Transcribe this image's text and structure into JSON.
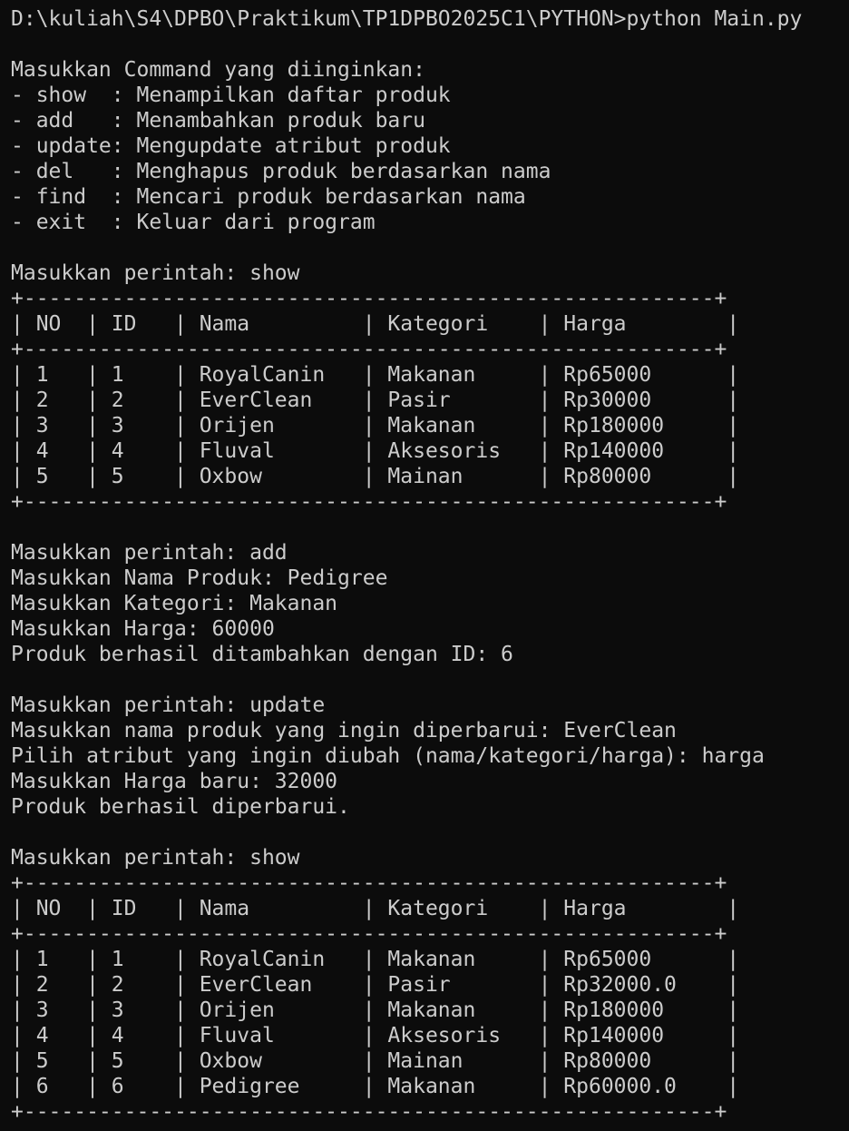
{
  "terminal": {
    "lines": [
      "D:\\kuliah\\S4\\DPBO\\Praktikum\\TP1DPBO2025C1\\PYTHON>python Main.py",
      "",
      "Masukkan Command yang diinginkan:",
      "- show  : Menampilkan daftar produk",
      "- add   : Menambahkan produk baru",
      "- update: Mengupdate atribut produk",
      "- del   : Menghapus produk berdasarkan nama",
      "- find  : Mencari produk berdasarkan nama",
      "- exit  : Keluar dari program",
      "",
      "Masukkan perintah: show",
      "+-------------------------------------------------------+",
      "| NO  | ID   | Nama         | Kategori    | Harga        |",
      "+-------------------------------------------------------+",
      "| 1   | 1    | RoyalCanin   | Makanan     | Rp65000      |",
      "| 2   | 2    | EverClean    | Pasir       | Rp30000      |",
      "| 3   | 3    | Orijen       | Makanan     | Rp180000     |",
      "| 4   | 4    | Fluval       | Aksesoris   | Rp140000     |",
      "| 5   | 5    | Oxbow        | Mainan      | Rp80000      |",
      "+-------------------------------------------------------+",
      "",
      "Masukkan perintah: add",
      "Masukkan Nama Produk: Pedigree",
      "Masukkan Kategori: Makanan",
      "Masukkan Harga: 60000",
      "Produk berhasil ditambahkan dengan ID: 6",
      "",
      "Masukkan perintah: update",
      "Masukkan nama produk yang ingin diperbarui: EverClean",
      "Pilih atribut yang ingin diubah (nama/kategori/harga): harga",
      "Masukkan Harga baru: 32000",
      "Produk berhasil diperbarui.",
      "",
      "Masukkan perintah: show",
      "+-------------------------------------------------------+",
      "| NO  | ID   | Nama         | Kategori    | Harga        |",
      "+-------------------------------------------------------+",
      "| 1   | 1    | RoyalCanin   | Makanan     | Rp65000      |",
      "| 2   | 2    | EverClean    | Pasir       | Rp32000.0    |",
      "| 3   | 3    | Orijen       | Makanan     | Rp180000     |",
      "| 4   | 4    | Fluval       | Aksesoris   | Rp140000     |",
      "| 5   | 5    | Oxbow        | Mainan      | Rp80000      |",
      "| 6   | 6    | Pedigree     | Makanan     | Rp60000.0    |",
      "+-------------------------------------------------------+"
    ]
  },
  "colors": {
    "background": "#0c0c0c",
    "text": "#cccccc"
  }
}
